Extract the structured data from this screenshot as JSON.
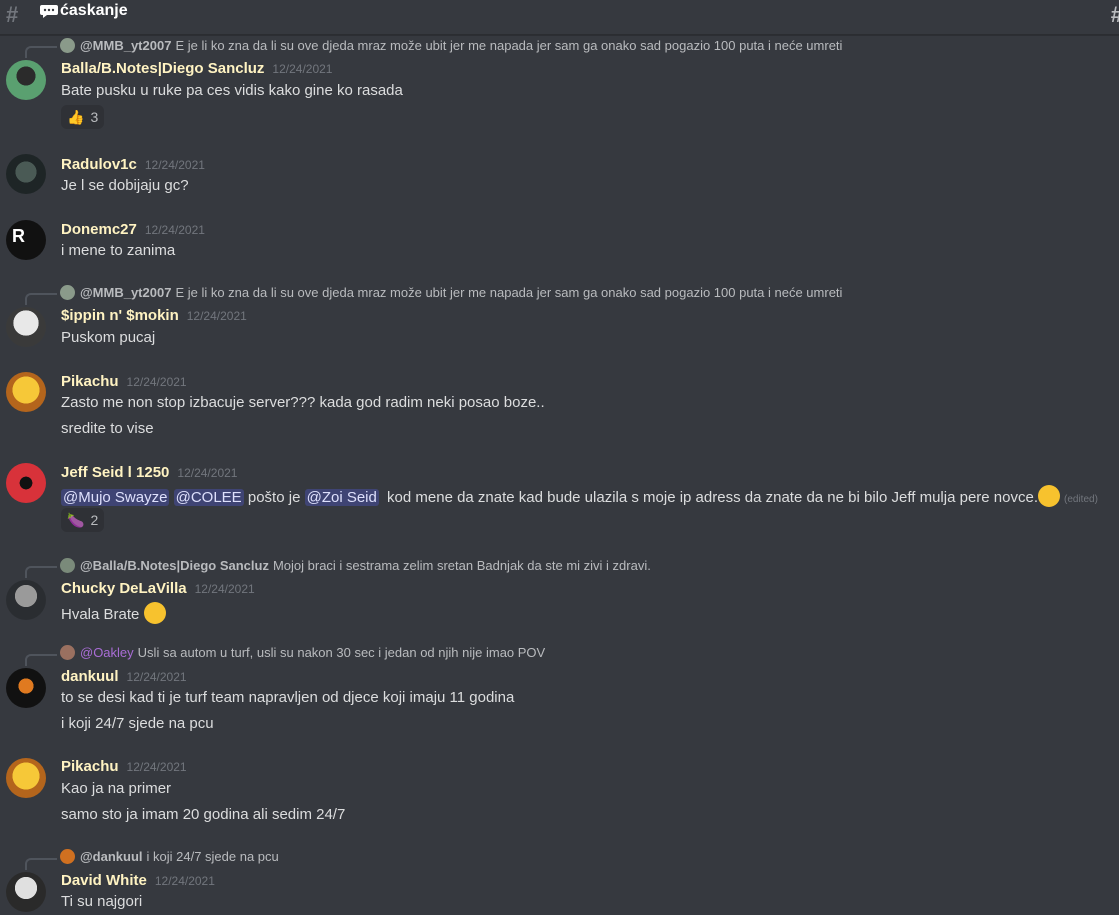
{
  "channel": {
    "name": "ćaskanje"
  },
  "messages": [
    {
      "reply": {
        "author": "@MMB_yt2007",
        "text": "E je li ko zna da li su ove djeda mraz može ubit jer me napada jer sam ga onako sad pogazio 100 puta i neće umreti"
      },
      "author": "Balla/B.Notes|Diego Sancluz",
      "timestamp": "12/24/2021",
      "lines": [
        "Bate pusku u ruke pa ces vidis kako gine ko rasada"
      ],
      "reaction": {
        "emoji": "thumbs-up",
        "glyph": "👍",
        "count": "3"
      }
    },
    {
      "author": "Radulov1c",
      "timestamp": "12/24/2021",
      "lines": [
        "Je l se dobijaju gc?"
      ]
    },
    {
      "author": "Donemc27",
      "timestamp": "12/24/2021",
      "lines": [
        "i mene to zanima"
      ]
    },
    {
      "reply": {
        "author": "@MMB_yt2007",
        "text": "E je li ko zna da li su ove djeda mraz može ubit jer me napada jer sam ga onako sad pogazio 100 puta i neće umreti"
      },
      "author": "$ippin n' $mokin",
      "timestamp": "12/24/2021",
      "lines": [
        "Puskom pucaj"
      ]
    },
    {
      "author": "Pikachu",
      "timestamp": "12/24/2021",
      "lines": [
        "Zasto me non stop izbacuje server??? kada god radim neki posao boze..",
        "sredite to vise"
      ]
    },
    {
      "author": "Jeff Seid l 1250",
      "timestamp": "12/24/2021",
      "mentions": [
        "@Mujo Swayze",
        "@COLEE",
        "@Zoi Seid"
      ],
      "text_a": "pošto je",
      "text_b": "kod mene da znate kad bude ulazila s moje ip adress da znate da ne bi bilo Jeff mulja pere novce.",
      "edited": "(edited)",
      "reaction": {
        "emoji": "eggplant",
        "glyph": "🍆",
        "count": "2"
      }
    },
    {
      "reply": {
        "author": "@Balla/B.Notes|Diego Sancluz",
        "text": "Mojoj braci i sestrama zelim sretan Badnjak da ste mi zivi i zdravi."
      },
      "author": "Chucky DeLaVilla",
      "timestamp": "12/24/2021",
      "lines": [
        "Hvala Brate"
      ]
    },
    {
      "reply": {
        "author": "@Oakley",
        "text": "Usli sa autom u turf, usli su nakon 30 sec i jedan od njih nije imao POV"
      },
      "author": "dankuul",
      "timestamp": "12/24/2021",
      "lines": [
        "to se desi kad ti je turf team napravljen od djece koji imaju 11 godina",
        "i koji 24/7 sjede na pcu"
      ]
    },
    {
      "author": "Pikachu",
      "timestamp": "12/24/2021",
      "lines": [
        "Kao ja na primer",
        "samo sto ja imam 20 godina ali sedim 24/7"
      ]
    },
    {
      "reply": {
        "author": "@dankuul",
        "text": "i koji 24/7 sjede na pcu"
      },
      "author": "David White",
      "timestamp": "12/24/2021",
      "lines": [
        "Ti su najgori"
      ]
    }
  ]
}
